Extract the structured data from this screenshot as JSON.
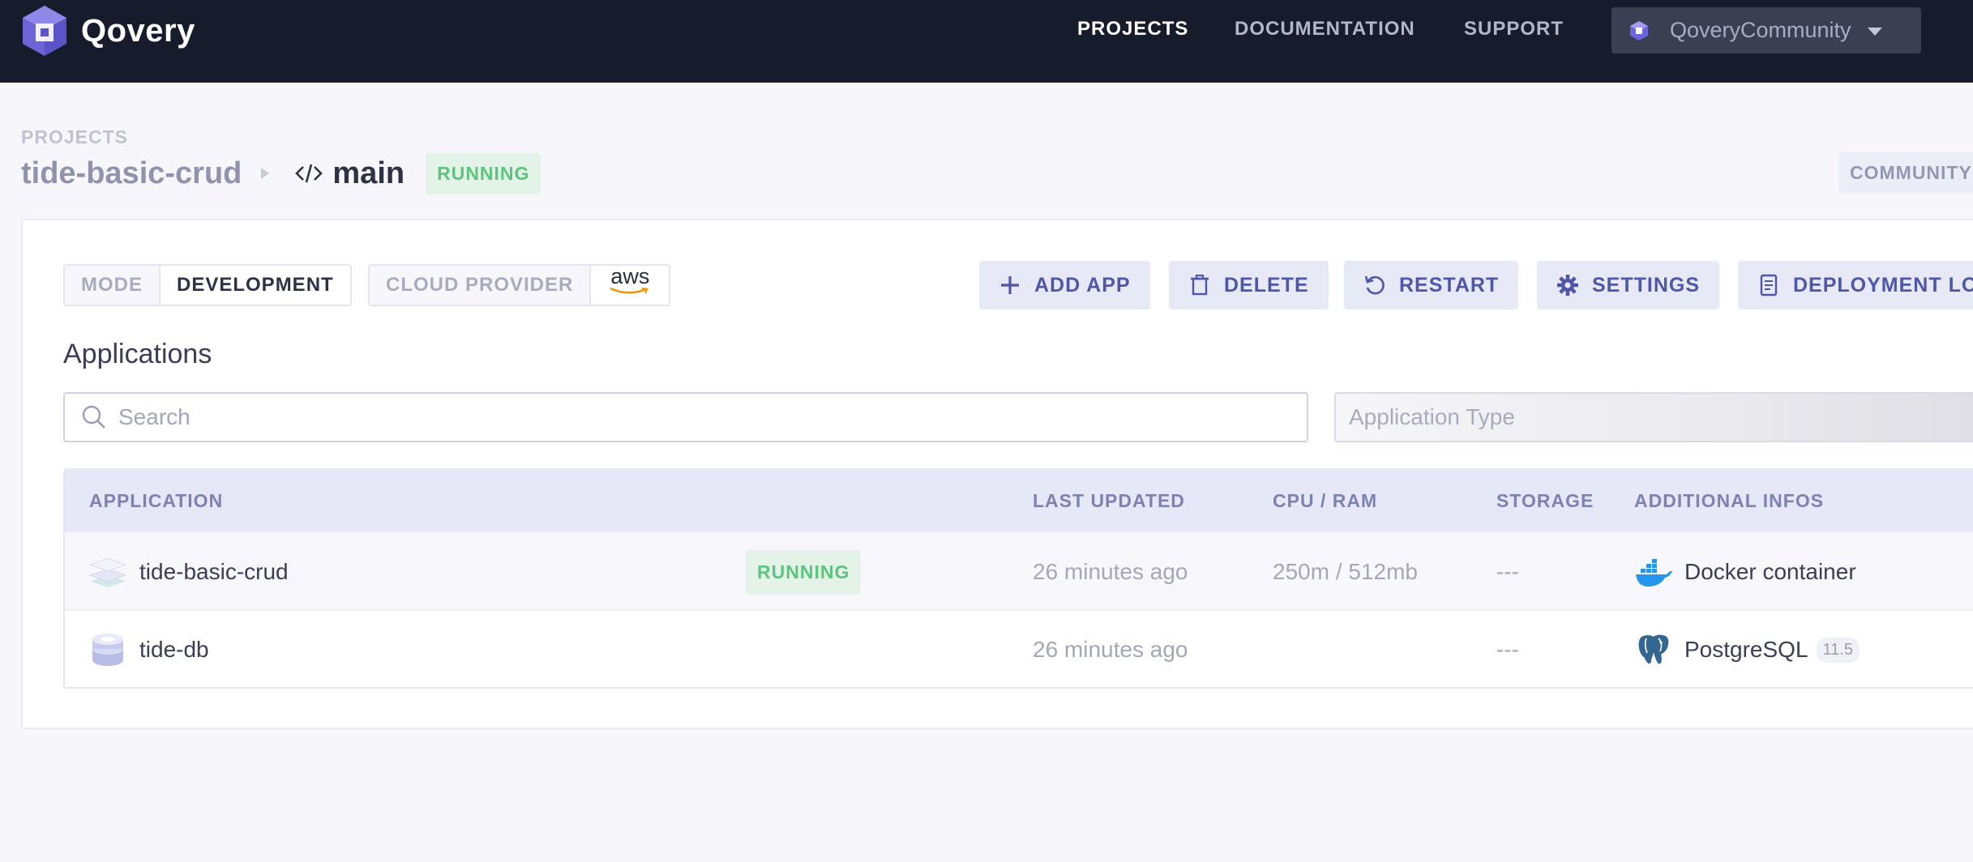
{
  "nav": {
    "brand": "Qovery",
    "links": [
      "PROJECTS",
      "DOCUMENTATION",
      "SUPPORT"
    ],
    "org": "QoveryCommunity"
  },
  "header": {
    "crumb_label": "PROJECTS",
    "project": "tide-basic-crud",
    "environment": "main",
    "status": "RUNNING",
    "plan": "COMMUNITY"
  },
  "env_info": {
    "mode_label": "MODE",
    "mode_value": "DEVELOPMENT",
    "provider_label": "CLOUD PROVIDER",
    "provider_value": "aws"
  },
  "actions": {
    "add_app": "ADD APP",
    "delete": "DELETE",
    "restart": "RESTART",
    "settings": "SETTINGS",
    "deployment_logs": "DEPLOYMENT LOG"
  },
  "applications": {
    "title": "Applications",
    "search_placeholder": "Search",
    "type_placeholder": "Application Type",
    "columns": [
      "APPLICATION",
      "LAST UPDATED",
      "CPU / RAM",
      "STORAGE",
      "ADDITIONAL INFOS"
    ],
    "rows": [
      {
        "name": "tide-basic-crud",
        "icon": "stack-layers-icon",
        "status": "RUNNING",
        "last_updated": "26 minutes ago",
        "cpu_ram": "250m / 512mb",
        "storage": "---",
        "info_icon": "docker-icon",
        "info": "Docker container",
        "version": ""
      },
      {
        "name": "tide-db",
        "icon": "database-icon",
        "status": "",
        "last_updated": "26 minutes ago",
        "cpu_ram": "",
        "storage": "---",
        "info_icon": "postgresql-icon",
        "info": "PostgreSQL",
        "version": "11.5"
      }
    ]
  },
  "colors": {
    "topbar": "#171c2d",
    "accent": "#4f56a8",
    "running_bg": "#e4f3e8",
    "running_text": "#5cc47d"
  }
}
